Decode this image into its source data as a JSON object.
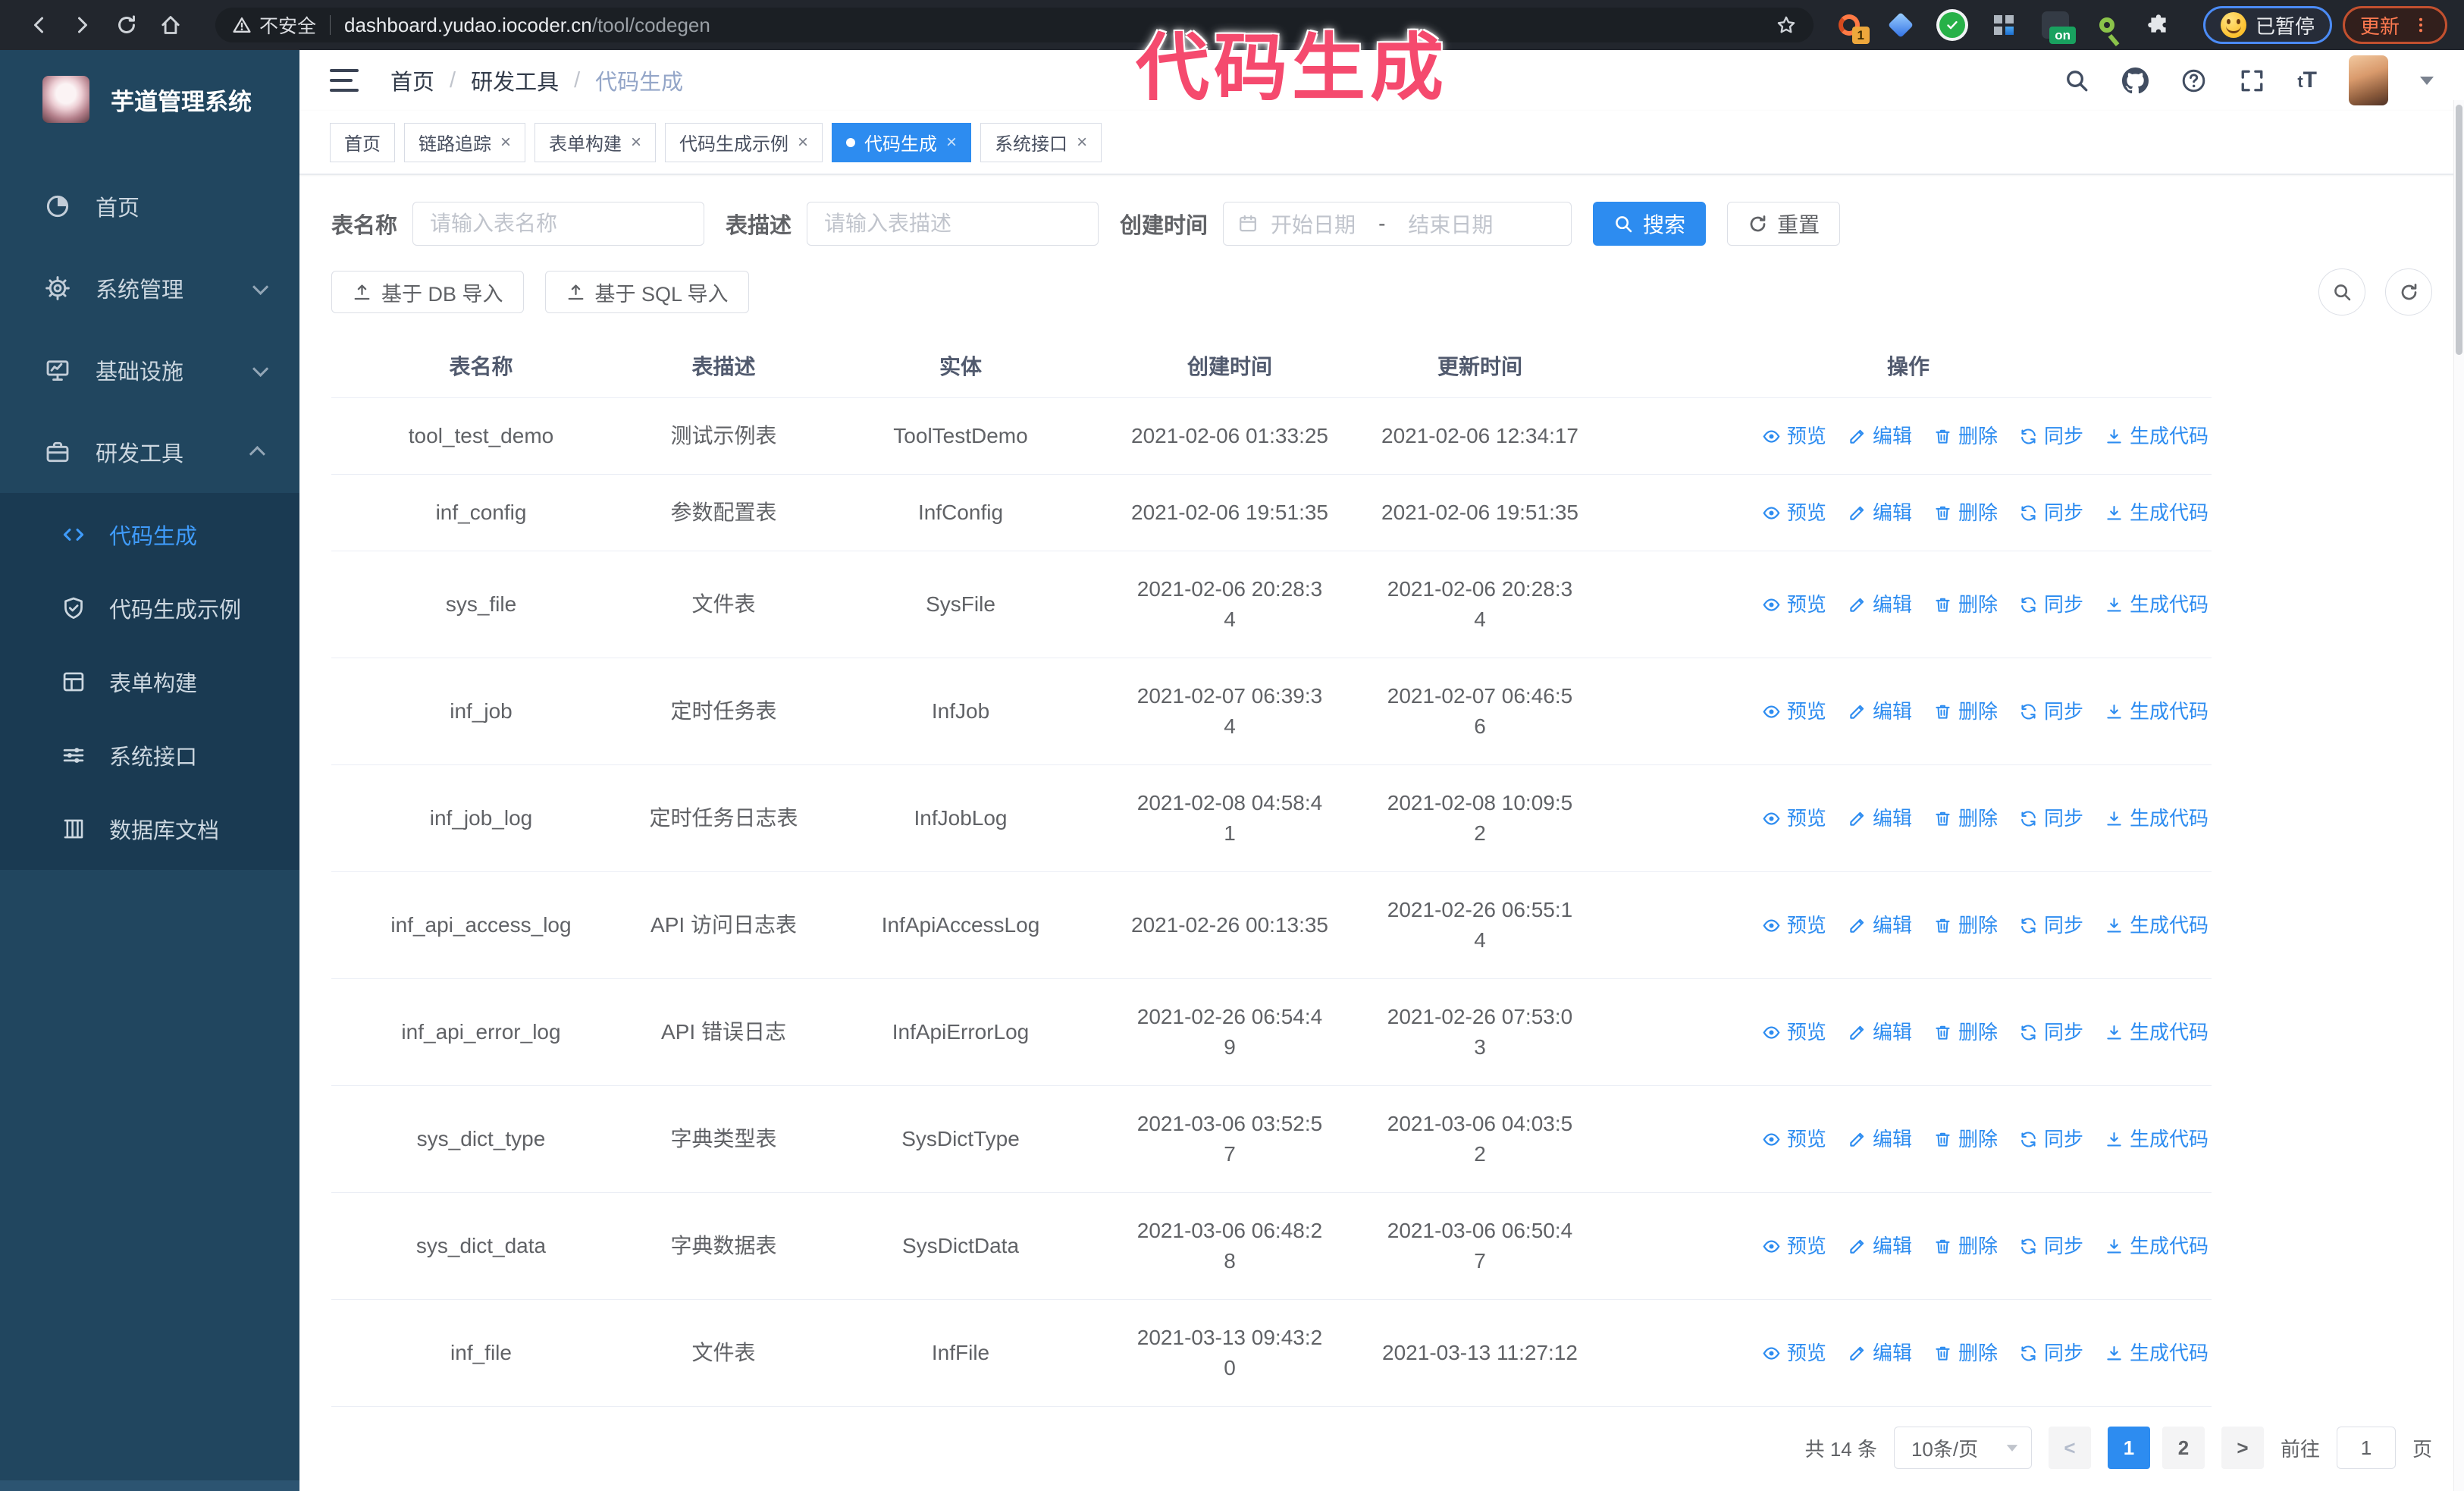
{
  "browser": {
    "security_label": "不安全",
    "url_domain": "dashboard.yudao.iocoder.cn",
    "url_path": "/tool/codegen",
    "extension_badge": "1",
    "extension_on_badge": "on",
    "paused_badge": "已暂停",
    "update_label": "更新"
  },
  "annotation": {
    "text": "代码生成",
    "color": "#f54a6e"
  },
  "sidebar": {
    "title": "芋道管理系统",
    "menu": [
      {
        "label": "首页",
        "icon": "pie",
        "chev": ""
      },
      {
        "label": "系统管理",
        "icon": "gear",
        "chev": "down"
      },
      {
        "label": "基础设施",
        "icon": "monitor",
        "chev": "down"
      },
      {
        "label": "研发工具",
        "icon": "tools",
        "chev": "up"
      }
    ],
    "submenu": [
      {
        "label": "代码生成",
        "icon": "code",
        "active": true
      },
      {
        "label": "代码生成示例",
        "icon": "shield",
        "active": false
      },
      {
        "label": "表单构建",
        "icon": "form",
        "active": false
      },
      {
        "label": "系统接口",
        "icon": "sliders",
        "active": false
      },
      {
        "label": "数据库文档",
        "icon": "db",
        "active": false
      }
    ]
  },
  "header": {
    "breadcrumb": [
      "首页",
      "研发工具",
      "代码生成"
    ],
    "separator": "/"
  },
  "tabs": [
    {
      "label": "首页",
      "closable": false,
      "active": false
    },
    {
      "label": "链路追踪",
      "closable": true,
      "active": false
    },
    {
      "label": "表单构建",
      "closable": true,
      "active": false
    },
    {
      "label": "代码生成示例",
      "closable": true,
      "active": false
    },
    {
      "label": "代码生成",
      "closable": true,
      "active": true
    },
    {
      "label": "系统接口",
      "closable": true,
      "active": false
    }
  ],
  "filters": {
    "table_name_label": "表名称",
    "table_name_placeholder": "请输入表名称",
    "table_desc_label": "表描述",
    "table_desc_placeholder": "请输入表描述",
    "create_time_label": "创建时间",
    "start_placeholder": "开始日期",
    "range_separator": "-",
    "end_placeholder": "结束日期",
    "search_label": "搜索",
    "reset_label": "重置"
  },
  "toolbar": {
    "import_db_label": "基于 DB 导入",
    "import_sql_label": "基于 SQL 导入"
  },
  "table": {
    "columns": [
      "表名称",
      "表描述",
      "实体",
      "创建时间",
      "更新时间",
      "操作"
    ],
    "actions": [
      {
        "label": "预览",
        "icon": "eye"
      },
      {
        "label": "编辑",
        "icon": "edit"
      },
      {
        "label": "删除",
        "icon": "del"
      },
      {
        "label": "同步",
        "icon": "sync"
      },
      {
        "label": "生成代码",
        "icon": "down"
      }
    ],
    "rows": [
      {
        "name": "tool_test_demo",
        "desc": "测试示例表",
        "entity": "ToolTestDemo",
        "created": "2021-02-06 01:33:25",
        "updated": "2021-02-06 12:34:17"
      },
      {
        "name": "inf_config",
        "desc": "参数配置表",
        "entity": "InfConfig",
        "created": "2021-02-06 19:51:35",
        "updated": "2021-02-06 19:51:35"
      },
      {
        "name": "sys_file",
        "desc": "文件表",
        "entity": "SysFile",
        "created": "2021-02-06 20:28:3\n4",
        "updated": "2021-02-06 20:28:3\n4"
      },
      {
        "name": "inf_job",
        "desc": "定时任务表",
        "entity": "InfJob",
        "created": "2021-02-07 06:39:3\n4",
        "updated": "2021-02-07 06:46:5\n6"
      },
      {
        "name": "inf_job_log",
        "desc": "定时任务日志表",
        "entity": "InfJobLog",
        "created": "2021-02-08 04:58:4\n1",
        "updated": "2021-02-08 10:09:5\n2"
      },
      {
        "name": "inf_api_access_log",
        "desc": "API 访问日志表",
        "entity": "InfApiAccessLog",
        "created": "2021-02-26 00:13:35",
        "updated": "2021-02-26 06:55:1\n4"
      },
      {
        "name": "inf_api_error_log",
        "desc": "API 错误日志",
        "entity": "InfApiErrorLog",
        "created": "2021-02-26 06:54:4\n9",
        "updated": "2021-02-26 07:53:0\n3"
      },
      {
        "name": "sys_dict_type",
        "desc": "字典类型表",
        "entity": "SysDictType",
        "created": "2021-03-06 03:52:5\n7",
        "updated": "2021-03-06 04:03:5\n2"
      },
      {
        "name": "sys_dict_data",
        "desc": "字典数据表",
        "entity": "SysDictData",
        "created": "2021-03-06 06:48:2\n8",
        "updated": "2021-03-06 06:50:4\n7"
      },
      {
        "name": "inf_file",
        "desc": "文件表",
        "entity": "InfFile",
        "created": "2021-03-13 09:43:2\n0",
        "updated": "2021-03-13 11:27:12"
      }
    ]
  },
  "pagination": {
    "total_label": "共 14 条",
    "page_size": "10条/页",
    "prev": "<",
    "next": ">",
    "pages": [
      "1",
      "2"
    ],
    "active_page": "1",
    "goto_label": "前往",
    "goto_value": "1",
    "page_label": "页"
  }
}
